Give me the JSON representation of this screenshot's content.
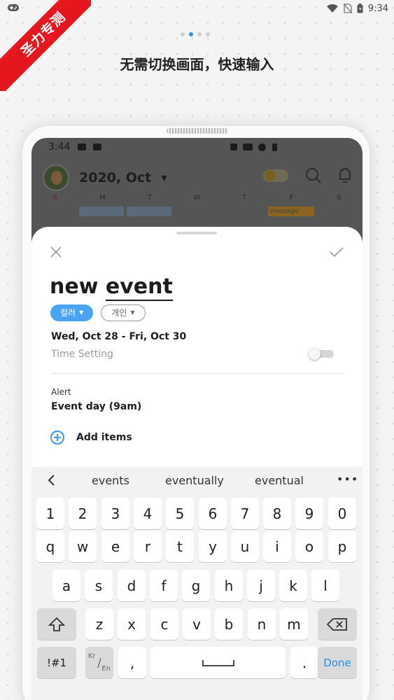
{
  "status_bar": {
    "time": "9:34"
  },
  "ribbon": {
    "text": "圣力专测"
  },
  "promo": {
    "title": "无需切换画面，快速输入",
    "pages": 4,
    "active_page": 1
  },
  "inner_status": {
    "time": "3:44"
  },
  "calendar": {
    "title": "2020, Oct",
    "weekdays": [
      "S",
      "M",
      "T",
      "W",
      "T",
      "F",
      "S"
    ],
    "chip_label": "message"
  },
  "sheet": {
    "title_word1": "new",
    "title_word2": "event",
    "chip_color": "컬러",
    "chip_private": "개인",
    "date_range": "Wed, Oct 28 - Fri, Oct 30",
    "time_setting": "Time Setting",
    "time_setting_on": false,
    "alert_label": "Alert",
    "alert_value": "Event day (9am)",
    "add_items": "Add items"
  },
  "keyboard": {
    "suggestions": [
      "events",
      "eventually",
      "eventual"
    ],
    "row_numbers": [
      "1",
      "2",
      "3",
      "4",
      "5",
      "6",
      "7",
      "8",
      "9",
      "0"
    ],
    "row_q": [
      "q",
      "w",
      "e",
      "r",
      "t",
      "y",
      "u",
      "i",
      "o",
      "p"
    ],
    "row_a": [
      "a",
      "s",
      "d",
      "f",
      "g",
      "h",
      "j",
      "k",
      "l"
    ],
    "row_z": [
      "z",
      "x",
      "c",
      "v",
      "b",
      "n",
      "m"
    ],
    "symbols": "!#1",
    "lang_kr": "Kr",
    "lang_en": "En",
    "comma": ",",
    "period": ".",
    "done": "Done"
  },
  "colors": {
    "accent": "#4aa3f0",
    "done": "#2a8de2",
    "ribbon": "#e5161d",
    "pager_active": "#2a90e6"
  }
}
